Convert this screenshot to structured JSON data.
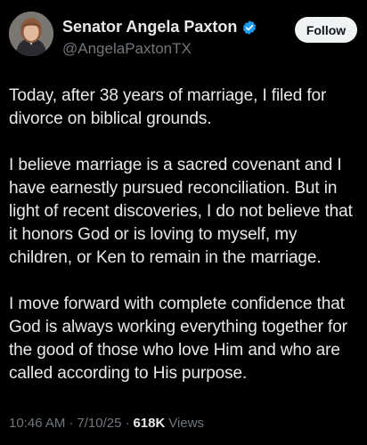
{
  "profile": {
    "display_name": "Senator Angela Paxton",
    "handle": "@AngelaPaxtonTX",
    "verified_icon": "verified-badge-icon",
    "verified_color": "#1d9bf0",
    "follow_label": "Follow"
  },
  "tweet": {
    "paragraphs": [
      "Today, after 38 years of marriage, I filed for divorce on biblical grounds.",
      "I believe marriage is a sacred covenant and I have earnestly pursued reconciliation. But in light of recent discoveries, I do not believe that it honors God or is loving to myself, my children, or Ken to remain in the marriage.",
      "I move forward with complete confidence that God is always working everything together for the good of those who love Him and who are called according to His purpose."
    ],
    "time": "10:46 AM",
    "separator": "·",
    "date": "7/10/25",
    "views_count": "618K",
    "views_label": "Views"
  }
}
